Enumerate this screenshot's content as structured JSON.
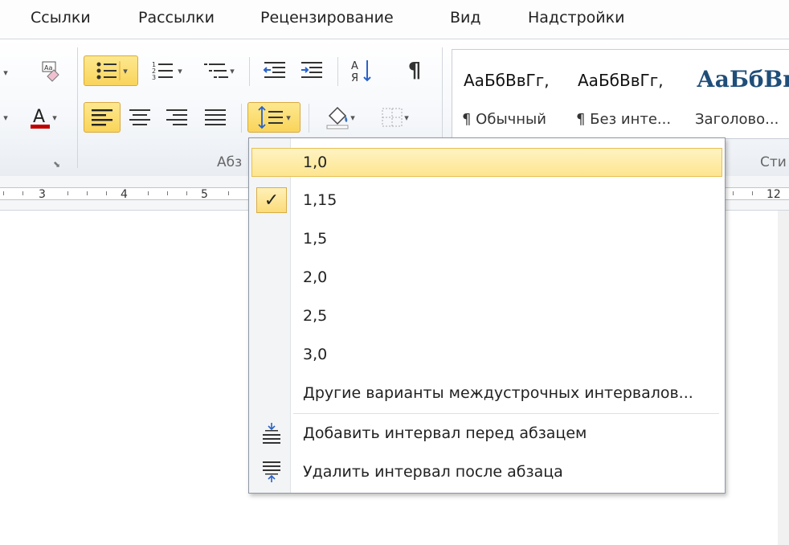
{
  "tabs": [
    "Ссылки",
    "Рассылки",
    "Рецензирование",
    "Вид",
    "Надстройки"
  ],
  "ribbon": {
    "groups": {
      "paragraph_partial": "Абз",
      "styles_partial": "Сти"
    },
    "styles": [
      {
        "sample": "АаБбВвГг,",
        "name": "¶ Обычный"
      },
      {
        "sample": "АаБбВвГг,",
        "name": "¶ Без инте..."
      },
      {
        "sample": "АаБбВı",
        "name": "Заголово..."
      }
    ],
    "colors": {
      "font_color": "#c00000",
      "highlight": "#f9d45a"
    }
  },
  "ruler": {
    "numbers": [
      {
        "label": "3"
      },
      {
        "label": "4"
      },
      {
        "label": "5"
      },
      {
        "label": "12"
      }
    ]
  },
  "menu": {
    "items": [
      {
        "label": "1,0",
        "highlighted": true
      },
      {
        "label": "1,15",
        "checked": true
      },
      {
        "label": "1,5"
      },
      {
        "label": "2,0"
      },
      {
        "label": "2,5"
      },
      {
        "label": "3,0"
      },
      {
        "label": "Другие варианты междустрочных интервалов..."
      }
    ],
    "actions": [
      {
        "label": "Добавить интервал перед абзацем",
        "icon": "add-space-before-icon"
      },
      {
        "label": "Удалить интервал после абзаца",
        "icon": "remove-space-after-icon"
      }
    ]
  }
}
